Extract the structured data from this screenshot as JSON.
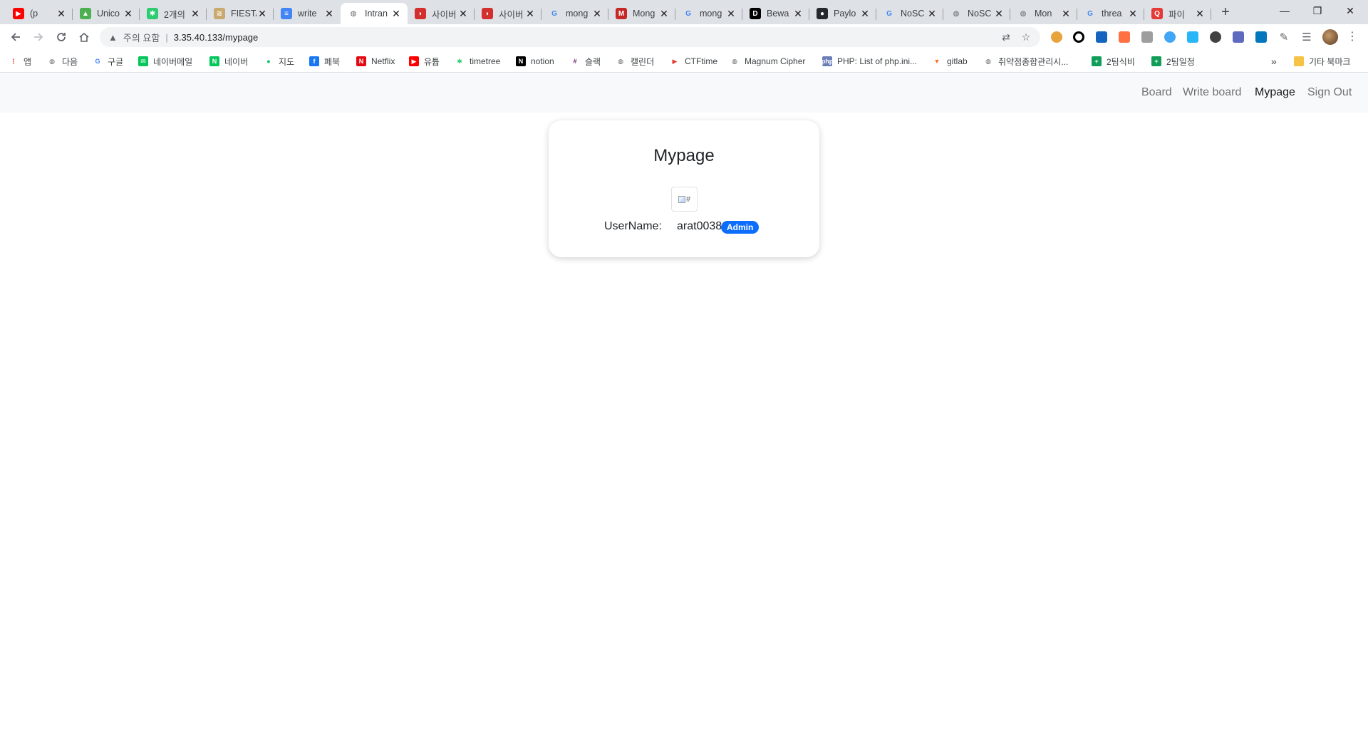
{
  "browser": {
    "tabs": [
      {
        "title": "(p",
        "favicon": "youtube-icon",
        "color": "#ff0000"
      },
      {
        "title": "Unico",
        "favicon": "unicorn-icon",
        "color": "#4caf50"
      },
      {
        "title": "2개의",
        "favicon": "asterisk-icon",
        "color": "#2ecc71"
      },
      {
        "title": "FIESTA",
        "favicon": "fiesta-icon",
        "color": "#c9a96e"
      },
      {
        "title": "write",
        "favicon": "docs-icon",
        "color": "#4285f4"
      },
      {
        "title": "Intran",
        "favicon": "globe-icon",
        "color": "#5f6368"
      },
      {
        "title": "사이버",
        "favicon": "dolphin-icon",
        "color": "#d32f2f"
      },
      {
        "title": "사이버",
        "favicon": "dolphin-icon",
        "color": "#d32f2f"
      },
      {
        "title": "mong",
        "favicon": "google-icon",
        "color": "#4285f4"
      },
      {
        "title": "Mong",
        "favicon": "medium-m-icon",
        "color": "#c62828"
      },
      {
        "title": "mong",
        "favicon": "google-icon",
        "color": "#4285f4"
      },
      {
        "title": "Bewa",
        "favicon": "dev-icon",
        "color": "#000000"
      },
      {
        "title": "Paylo",
        "favicon": "github-icon",
        "color": "#24292e"
      },
      {
        "title": "NoSC",
        "favicon": "google-icon",
        "color": "#4285f4"
      },
      {
        "title": "NoSC",
        "favicon": "globe-icon",
        "color": "#5f6368"
      },
      {
        "title": "Mon",
        "favicon": "globe-icon",
        "color": "#5f6368"
      },
      {
        "title": "threa",
        "favicon": "google-icon",
        "color": "#4285f4"
      },
      {
        "title": "파이",
        "favicon": "qa-icon",
        "color": "#e53935"
      }
    ],
    "active_tab_index": 5,
    "favicon_letters": {
      "google": "G",
      "dev": "DEV",
      "qa": "QA",
      "medium": "M"
    },
    "omnibox": {
      "warning_label": "주의 요함",
      "url": "3.35.40.133/mypage"
    },
    "bookmarks": [
      {
        "label": "앱",
        "icon": "apps-grid-icon",
        "color": "#ea4335"
      },
      {
        "label": "다음",
        "icon": "globe-icon",
        "color": "#5f6368"
      },
      {
        "label": "구글",
        "icon": "google-icon",
        "color": "#4285f4"
      },
      {
        "label": "네이버메일",
        "icon": "naver-mail-icon",
        "color": "#03c75a"
      },
      {
        "label": "네이버",
        "icon": "naver-icon",
        "color": "#03c75a"
      },
      {
        "label": "지도",
        "icon": "map-pin-icon",
        "color": "#03c75a"
      },
      {
        "label": "페북",
        "icon": "facebook-icon",
        "color": "#1877f2"
      },
      {
        "label": "Netflix",
        "icon": "netflix-icon",
        "color": "#e50914"
      },
      {
        "label": "유튭",
        "icon": "youtube-icon",
        "color": "#ff0000"
      },
      {
        "label": "timetree",
        "icon": "asterisk-icon",
        "color": "#2ecc71"
      },
      {
        "label": "notion",
        "icon": "notion-icon",
        "color": "#000000"
      },
      {
        "label": "슬랙",
        "icon": "slack-icon",
        "color": "#611f69"
      },
      {
        "label": "캘린더",
        "icon": "globe-icon",
        "color": "#5f6368"
      },
      {
        "label": "CTFtime",
        "icon": "ctftime-flag-icon",
        "color": "#e53935"
      },
      {
        "label": "Magnum Cipher",
        "icon": "globe-icon",
        "color": "#5f6368"
      },
      {
        "label": "PHP: List of php.ini...",
        "icon": "php-icon",
        "color": "#6c7eb7"
      },
      {
        "label": "gitlab",
        "icon": "gitlab-icon",
        "color": "#fc6d26"
      },
      {
        "label": "취약점종합관리시...",
        "icon": "globe-icon",
        "color": "#5f6368"
      },
      {
        "label": "2팀식비",
        "icon": "sheets-plus-icon",
        "color": "#0f9d58"
      },
      {
        "label": "2팀일정",
        "icon": "sheets-plus-icon",
        "color": "#0f9d58"
      }
    ],
    "bookmarks_overflow": "»",
    "other_bookmarks": "기타 북마크"
  },
  "page": {
    "nav": {
      "board": "Board",
      "write_board": "Write board",
      "mypage": "Mypage",
      "sign_out": "Sign Out"
    },
    "card": {
      "title": "Mypage",
      "image_alt": "#",
      "username_label": "UserName:",
      "username_value": "arat0038",
      "role_badge": "Admin"
    },
    "colors": {
      "navbar_bg": "#f8f9fa",
      "badge_bg": "#0d6efd"
    }
  }
}
